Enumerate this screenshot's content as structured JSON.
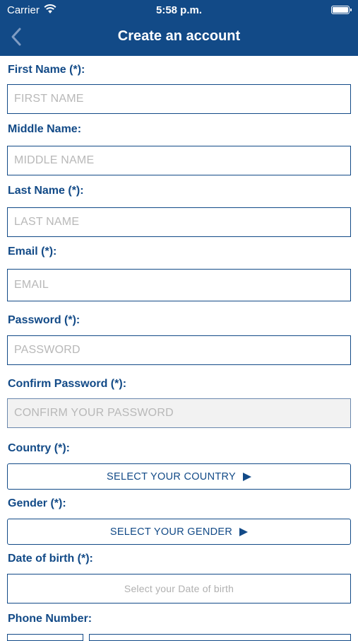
{
  "status_bar": {
    "carrier": "Carrier",
    "time": "5:58 p.m."
  },
  "nav": {
    "title": "Create an account"
  },
  "form": {
    "first_name": {
      "label": "First Name (*):",
      "placeholder": "FIRST NAME"
    },
    "middle_name": {
      "label": "Middle Name:",
      "placeholder": "MIDDLE NAME"
    },
    "last_name": {
      "label": "Last Name (*):",
      "placeholder": "LAST NAME"
    },
    "email": {
      "label": "Email (*):",
      "placeholder": "EMAIL"
    },
    "password": {
      "label": "Password (*):",
      "placeholder": "PASSWORD"
    },
    "confirm_password": {
      "label": "Confirm Password (*):",
      "placeholder": "CONFIRM YOUR PASSWORD"
    },
    "country": {
      "label": "Country (*):",
      "button": "SELECT YOUR COUNTRY"
    },
    "gender": {
      "label": "Gender (*):",
      "button": "SELECT YOUR GENDER"
    },
    "dob": {
      "label": "Date of birth (*):",
      "placeholder": "Select your Date of birth"
    },
    "phone": {
      "label": "Phone Number:"
    }
  },
  "colors": {
    "brand": "#124a87",
    "placeholder": "#b8b8b8",
    "disabled_bg": "#f2f2f2"
  }
}
